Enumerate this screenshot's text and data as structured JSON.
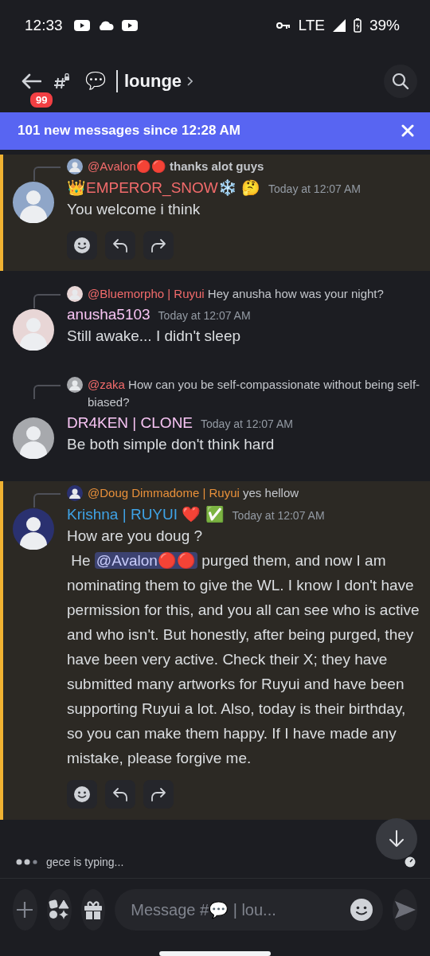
{
  "status_bar": {
    "time": "12:33",
    "network": "LTE",
    "battery": "39%"
  },
  "header": {
    "unread_badge": "99",
    "channel_emoji": "💬",
    "channel_name": "lounge"
  },
  "banner": {
    "text": "101 new messages since 12:28 AM"
  },
  "messages": [
    {
      "highlighted": true,
      "reply": {
        "author": "@Avalon🔴🔴",
        "color": "#f26b6b",
        "text": "thanks alot guys",
        "bold": true
      },
      "author": "👑EMPEROR_SNOW❄️ 🤔",
      "color": "#f26b6b",
      "time": "Today at 12:07 AM",
      "body": [
        {
          "kind": "text",
          "text": "You welcome i think"
        }
      ],
      "actions": true
    },
    {
      "highlighted": false,
      "reply": {
        "author": "@Bluemorpho | Ruyui",
        "color": "#f26b6b",
        "text": "Hey anusha how was your night?",
        "bold": false
      },
      "author": "anusha5103",
      "color": "#f7c4f3",
      "time": "Today at 12:07 AM",
      "body": [
        {
          "kind": "text",
          "text": "Still awake... I didn't sleep"
        }
      ],
      "actions": false
    },
    {
      "highlighted": false,
      "reply": {
        "author": "@zaka",
        "color": "#f26b6b",
        "text": "How can you be self-compassionate without being self-biased?",
        "bold": false
      },
      "author": "DR4KEN  | CLONE",
      "color": "#f7c4f3",
      "time": "Today at 12:07 AM",
      "body": [
        {
          "kind": "text",
          "text": "Be both simple don't think hard"
        }
      ],
      "actions": false
    },
    {
      "highlighted": true,
      "reply": {
        "author": "@Doug Dimmadome | Ruyui",
        "color": "#e8903a",
        "text": "yes hellow",
        "bold": false
      },
      "author": "Krishna | RUYUI ❤️ ✅",
      "color": "#3fa3e6",
      "time": "Today at 12:07 AM",
      "body": [
        {
          "kind": "text",
          "text": "How are you doug ?\n He "
        },
        {
          "kind": "mention",
          "text": "@Avalon🔴🔴"
        },
        {
          "kind": "text",
          "text": " purged them, and now I am nominating them to give the WL. I know I don't have permission for this, and you all can see who is active and who isn't. But honestly, after being purged, they have been very active. Check their X; they have submitted many artworks for Ruyui and have been supporting Ruyui a lot. Also, today is their birthday, so you can make them happy. If I have made any mistake, please forgive me."
        }
      ],
      "actions": true
    }
  ],
  "typing": {
    "text": "gece is typing..."
  },
  "composer": {
    "placeholder": "Message #💬 | lou..."
  }
}
